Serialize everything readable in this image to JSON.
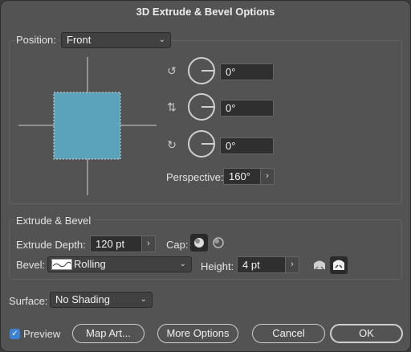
{
  "window": {
    "title": "3D Extrude & Bevel Options"
  },
  "position": {
    "label": "Position:",
    "value": "Front"
  },
  "rotation": {
    "x": {
      "value": "0°"
    },
    "y": {
      "value": "0°"
    },
    "z": {
      "value": "0°"
    }
  },
  "perspective": {
    "label": "Perspective:",
    "value": "160°"
  },
  "extrude": {
    "section_title": "Extrude & Bevel",
    "depth_label": "Extrude Depth:",
    "depth_value": "120 pt",
    "cap_label": "Cap:",
    "bevel_label": "Bevel:",
    "bevel_value": "Rolling",
    "height_label": "Height:",
    "height_value": "4 pt"
  },
  "surface": {
    "label": "Surface:",
    "value": "No Shading"
  },
  "footer": {
    "preview_label": "Preview",
    "preview_checked": true,
    "map_art_label": "Map Art...",
    "more_options_label": "More Options",
    "cancel_label": "Cancel",
    "ok_label": "OK"
  },
  "colors": {
    "cube_face": "#5ba3ba",
    "accent": "#3b82d6"
  },
  "icons": {
    "x_axis": "rotate-x-icon",
    "y_axis": "rotate-y-icon",
    "z_axis": "rotate-z-icon",
    "cap_on": "cap-on-icon",
    "cap_off": "cap-off-icon",
    "bevel_preview": "bevel-rolling-icon",
    "bevel_out": "bevel-out-icon",
    "bevel_in": "bevel-in-icon"
  }
}
